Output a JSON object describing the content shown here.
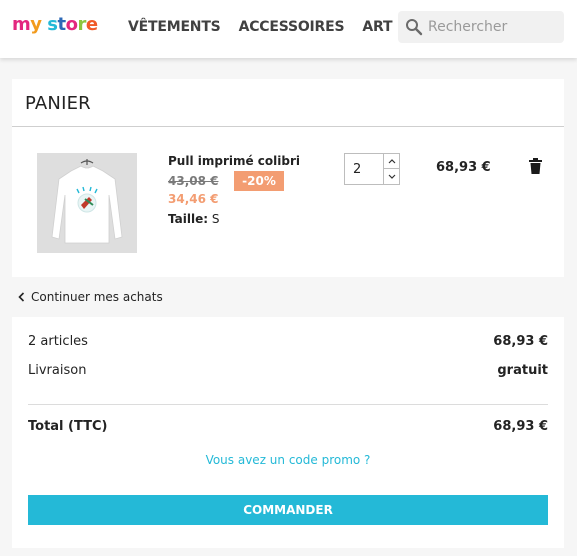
{
  "header": {
    "logo": {
      "w1": "my",
      "w2": "store"
    },
    "nav": [
      "VÊTEMENTS",
      "ACCESSOIRES",
      "ART"
    ],
    "search_placeholder": "Rechercher"
  },
  "cart": {
    "title": "PANIER",
    "item": {
      "name": "Pull imprimé colibri",
      "old_price": "43,08 €",
      "discount": "-20%",
      "new_price": "34,46 €",
      "size_label": "Taille:",
      "size_value": "S",
      "quantity": "2",
      "line_total": "68,93 €"
    }
  },
  "continue_label": "Continuer mes achats",
  "summary": {
    "articles_label": "2 articles",
    "articles_value": "68,93 €",
    "shipping_label": "Livraison",
    "shipping_value": "gratuit",
    "total_label": "Total (TTC)",
    "total_value": "68,93 €",
    "promo_link": "Vous avez un code promo ?",
    "order_button": "COMMANDER"
  },
  "colors": {
    "accent": "#24b9d7",
    "discount": "#f39d72",
    "background": "#f6f6f6"
  },
  "icons": [
    "search-icon",
    "chevron-up-icon",
    "chevron-down-icon",
    "trash-icon",
    "chevron-left-icon"
  ]
}
